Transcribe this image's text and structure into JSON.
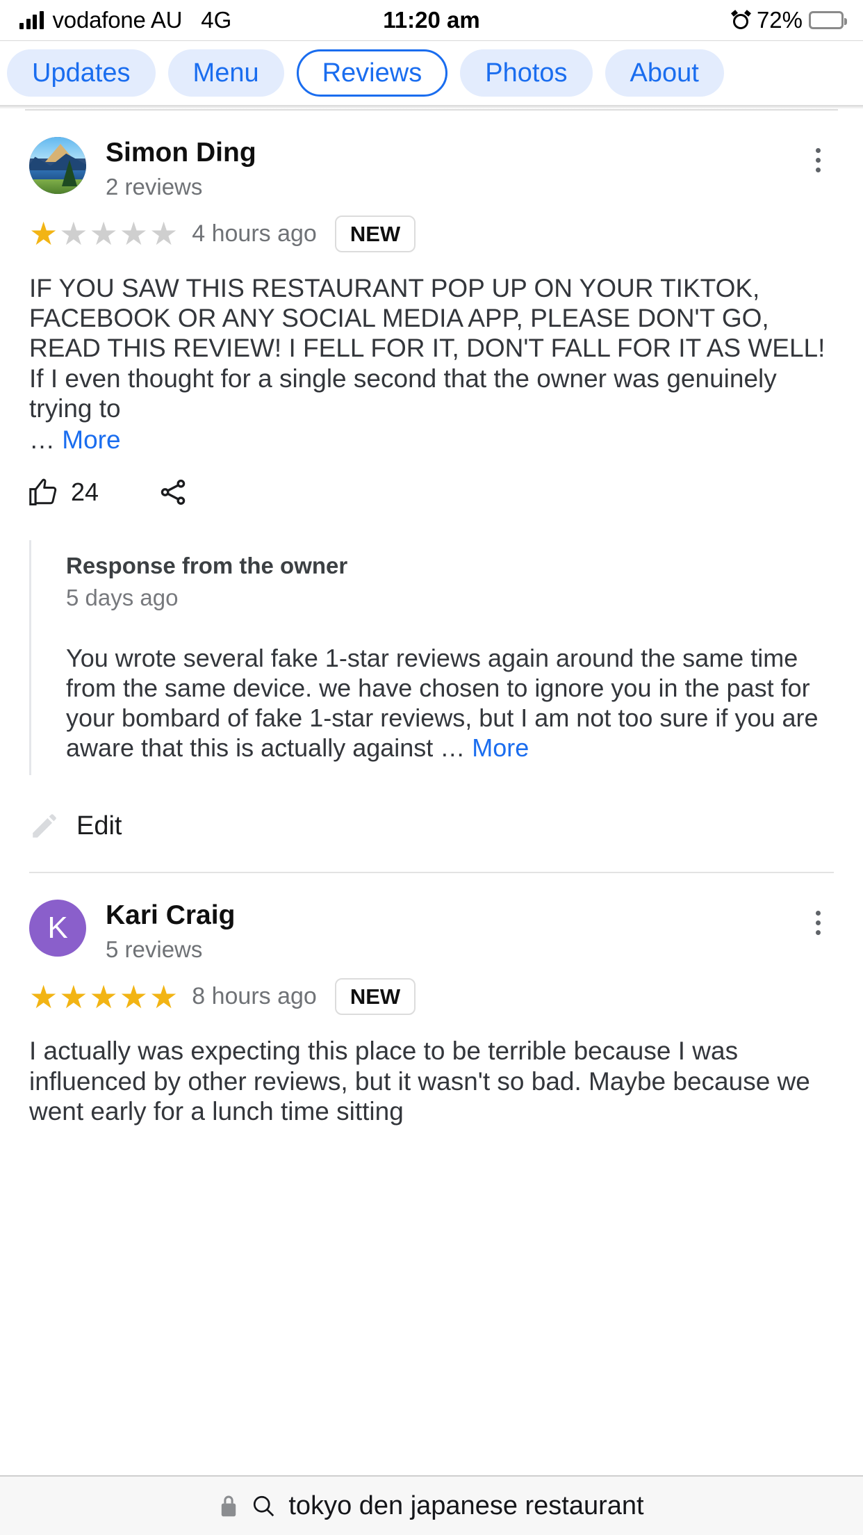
{
  "status_bar": {
    "carrier": "vodafone AU",
    "network": "4G",
    "time": "11:20 am",
    "battery_percent": "72%",
    "signal_icon": "signal-bars-icon",
    "alarm_icon": "alarm-clock-icon",
    "battery_icon": "battery-icon"
  },
  "tabs": [
    {
      "label": "Updates",
      "selected": false
    },
    {
      "label": "Menu",
      "selected": false
    },
    {
      "label": "Reviews",
      "selected": true
    },
    {
      "label": "Photos",
      "selected": false
    },
    {
      "label": "About",
      "selected": false
    }
  ],
  "reviews": [
    {
      "author": "Simon Ding",
      "review_count": "2 reviews",
      "avatar_type": "photo",
      "avatar_initial": "",
      "rating": 1,
      "max_rating": 5,
      "time_ago": "4 hours ago",
      "badge": "NEW",
      "text": "IF YOU SAW THIS RESTAURANT POP UP ON YOUR TIKTOK, FACEBOOK OR ANY SOCIAL MEDIA APP, PLEASE DON'T GO, READ THIS REVIEW! I FELL FOR IT, DON'T FALL FOR IT AS WELL!  If I even thought for a single second that the owner was genuinely trying to",
      "ellipsis": "… ",
      "more_label": "More",
      "like_count": "24",
      "like_icon": "thumbs-up-icon",
      "share_icon": "share-icon",
      "menu_icon": "overflow-menu-icon",
      "owner_response": {
        "title": "Response from the owner",
        "time_ago": "5 days ago",
        "text": "You wrote several fake 1-star reviews again around the same time from the same device. we have chosen to ignore you in the past for your bombard of fake 1-star reviews, but I am not too sure if you are aware that this is actually against ",
        "ellipsis": "… ",
        "more_label": "More"
      },
      "edit": {
        "label": "Edit",
        "icon": "pencil-icon"
      }
    },
    {
      "author": "Kari Craig",
      "review_count": "5 reviews",
      "avatar_type": "letter",
      "avatar_initial": "K",
      "avatar_color": "#8a5fcb",
      "rating": 5,
      "max_rating": 5,
      "time_ago": "8 hours ago",
      "badge": "NEW",
      "text": "I actually was expecting this place to be terrible because I was influenced by other reviews, but it wasn't so bad. Maybe because we went early for a lunch time sitting",
      "menu_icon": "overflow-menu-icon"
    }
  ],
  "bottom_bar": {
    "lock_icon": "lock-icon",
    "search_icon": "search-icon",
    "url": "tokyo den japanese restaurant"
  },
  "colors": {
    "accent_blue": "#1a6def",
    "tab_bg": "#e3ecfd",
    "star_gold": "#f2b414",
    "star_grey": "#cfcfcf",
    "avatar_purple": "#8a5fcb"
  }
}
